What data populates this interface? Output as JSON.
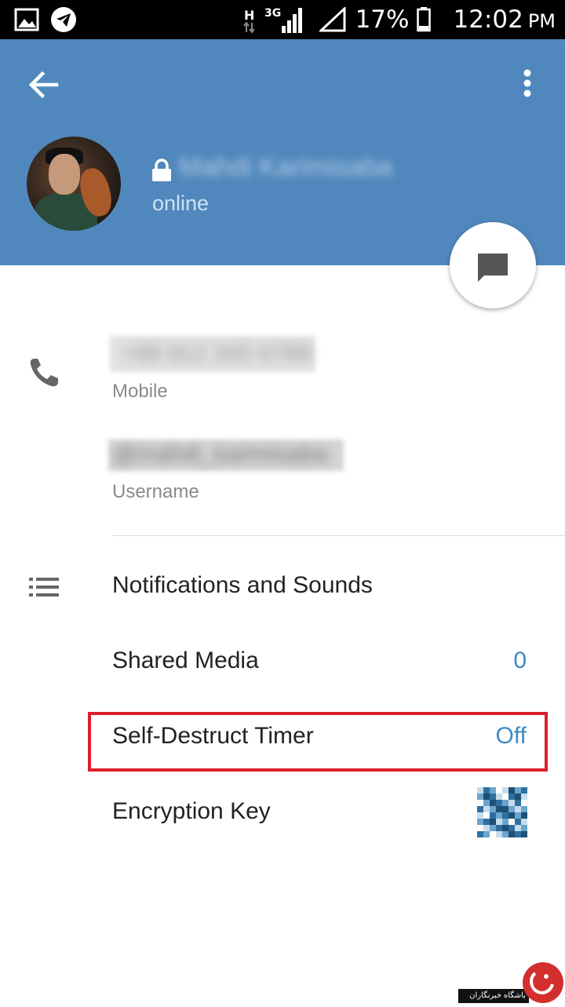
{
  "status_bar": {
    "network_h": "H",
    "network_3g": "3G",
    "battery": "17%",
    "time": "12:02",
    "ampm": "PM"
  },
  "header": {
    "contact_name": "Mahdi Karimisaba",
    "status": "online",
    "background_color": "#5088bd"
  },
  "info": {
    "phone_number": "+98 912 345 6789",
    "phone_label": "Mobile",
    "username": "@mahdi_karimisaba",
    "username_label": "Username"
  },
  "rows": {
    "notifications": {
      "label": "Notifications and Sounds"
    },
    "shared_media": {
      "label": "Shared Media",
      "value": "0"
    },
    "self_destruct": {
      "label": "Self-Destruct Timer",
      "value": "Off"
    },
    "encryption_key": {
      "label": "Encryption Key"
    }
  },
  "watermark": {
    "text": "باشگاه خبرنگاران"
  },
  "colors": {
    "accent": "#3d8bc4",
    "highlight_border": "#dc1e2a"
  }
}
